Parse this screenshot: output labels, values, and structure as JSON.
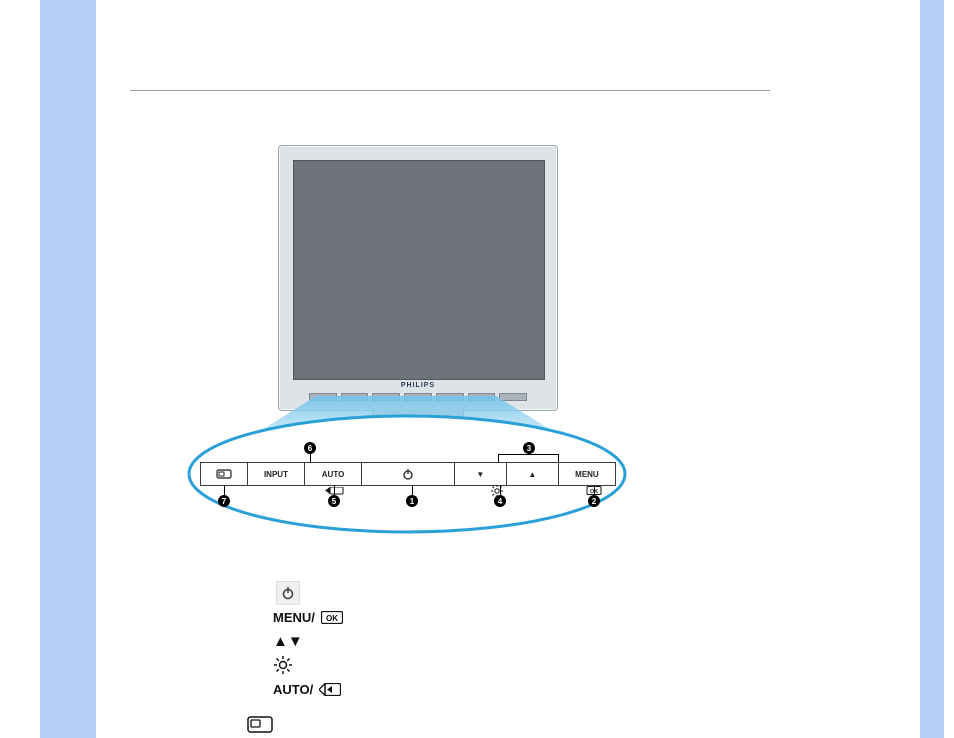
{
  "monitor": {
    "brand": "PHILIPS"
  },
  "buttons": {
    "b0_smartimage": "",
    "b1_input": "INPUT",
    "b2_auto": "AUTO",
    "b3_power": "",
    "b4_down": "▼",
    "b5_up": "▲",
    "b6_menu": "MENU"
  },
  "callouts": {
    "c1": "1",
    "c2": "2",
    "c3": "3",
    "c4": "4",
    "c5": "5",
    "c6": "6",
    "c7": "7"
  },
  "legend": {
    "l1_power": "",
    "l2_menu_ok": "MENU/",
    "l2_ok_glyph": "OK",
    "l3_up_down": "▲▼",
    "l4_brightness": "",
    "l5_auto_back": "AUTO/",
    "l5_back_glyph": "◀"
  }
}
